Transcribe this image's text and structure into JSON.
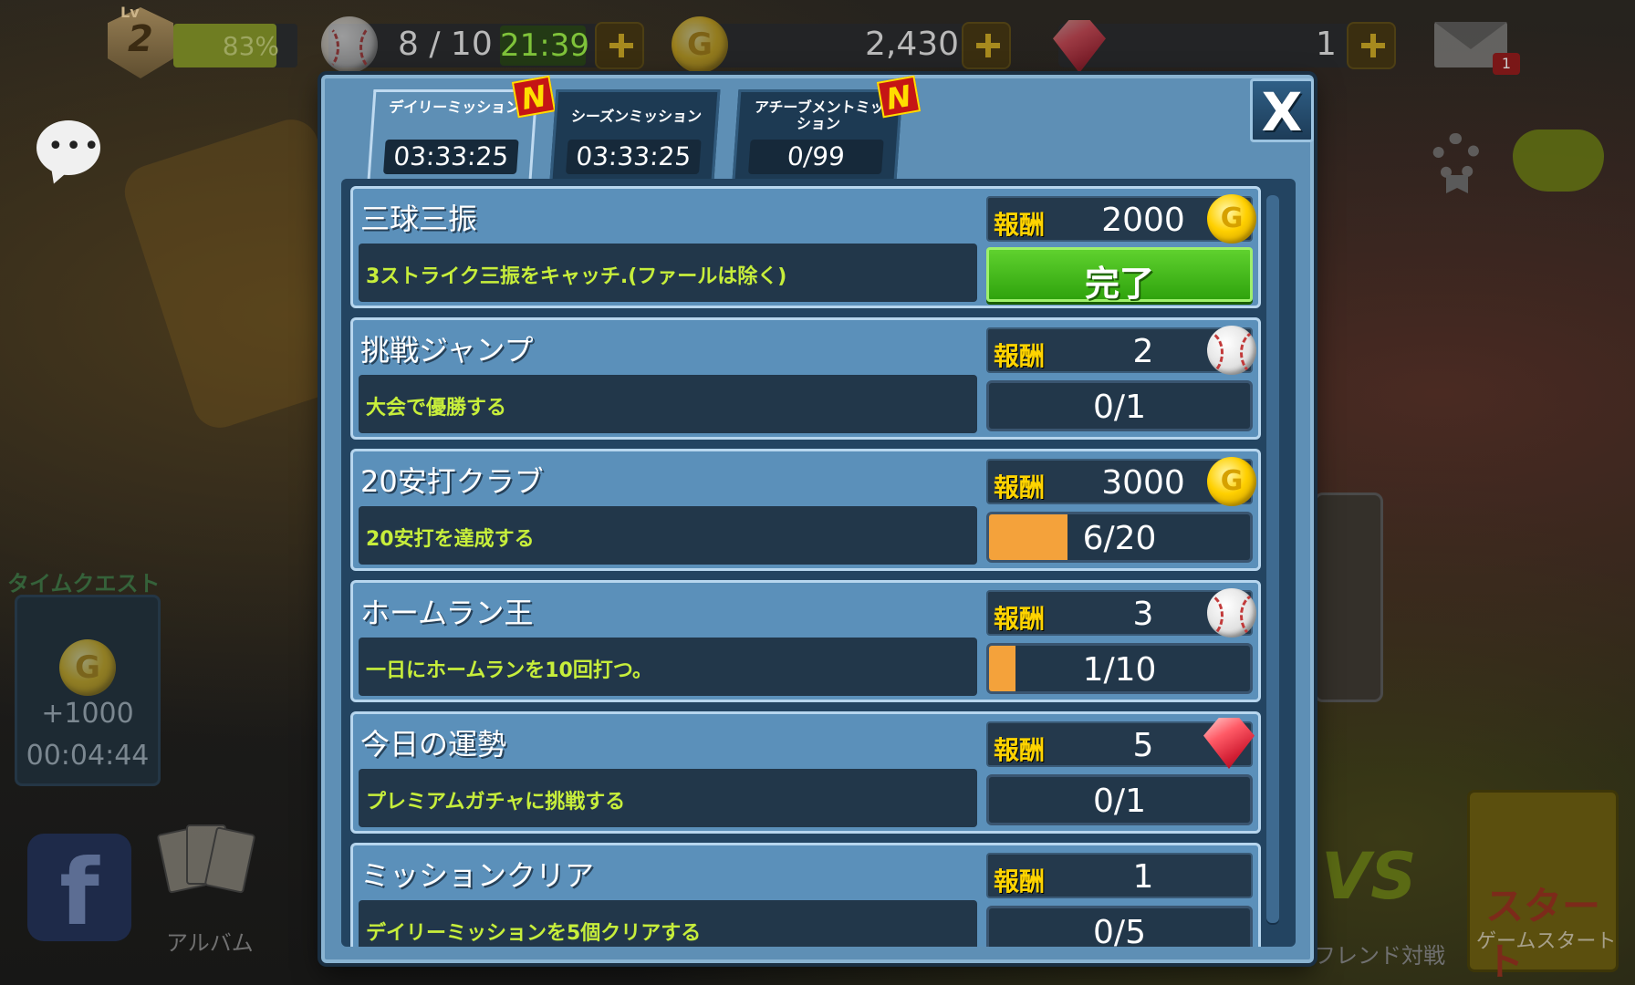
{
  "status": {
    "level_label": "Lv",
    "level": "2",
    "xp_percent": "83%",
    "xp_fraction": 0.83,
    "balls": "8 / 10",
    "ball_timer": "21:39",
    "coins": "2,430",
    "gems": "1",
    "mail_count": "1"
  },
  "side": {
    "time_quest_label": "タイムクエスト",
    "time_quest_reward": "+1000",
    "time_quest_timer": "00:04:44",
    "facebook_glyph": "f",
    "album_label": "アルバム",
    "friend_battle_label": "フレンド対戦",
    "vs_label": "VS",
    "start_label": "スタート",
    "game_start_label": "ゲームスタート"
  },
  "dialog": {
    "close_glyph": "X",
    "tabs": [
      {
        "label": "デイリーミッション",
        "value": "03:33:25",
        "badge": "N",
        "active": true
      },
      {
        "label": "シーズンミッション",
        "value": "03:33:25",
        "badge": "",
        "active": false
      },
      {
        "label": "アチーブメントミッション",
        "value": "0/99",
        "badge": "N",
        "active": false
      }
    ],
    "reward_label": "報酬",
    "complete_label": "完了",
    "missions": [
      {
        "title": "三球三振",
        "desc": "3ストライク三振をキャッチ.(ファールは除く)",
        "reward": "2000",
        "reward_icon": "coin-icon",
        "progress": "",
        "progress_fraction": 1.0,
        "completed": true
      },
      {
        "title": "挑戦ジャンプ",
        "desc": "大会で優勝する",
        "reward": "2",
        "reward_icon": "baseball-icon",
        "progress": "0/1",
        "progress_fraction": 0.0,
        "completed": false
      },
      {
        "title": "20安打クラブ",
        "desc": "20安打を達成する",
        "reward": "3000",
        "reward_icon": "coin-icon",
        "progress": "6/20",
        "progress_fraction": 0.3,
        "completed": false
      },
      {
        "title": "ホームラン王",
        "desc": "一日にホームランを10回打つ。",
        "reward": "3",
        "reward_icon": "baseball-icon",
        "progress": "1/10",
        "progress_fraction": 0.1,
        "completed": false
      },
      {
        "title": "今日の運勢",
        "desc": "プレミアムガチャに挑戦する",
        "reward": "5",
        "reward_icon": "gem-icon",
        "progress": "0/1",
        "progress_fraction": 0.0,
        "completed": false
      },
      {
        "title": "ミッションクリア",
        "desc": "デイリーミッションを5個クリアする",
        "reward": "1",
        "reward_icon": "none",
        "progress": "0/5",
        "progress_fraction": 0.0,
        "completed": false
      }
    ]
  },
  "colors": {
    "panel": "#5e8fb5",
    "desc_text": "#c7ee3b",
    "reward_label": "#ffd400",
    "progress_fill": "#f4a23b",
    "complete_green": "#2fa30d"
  }
}
